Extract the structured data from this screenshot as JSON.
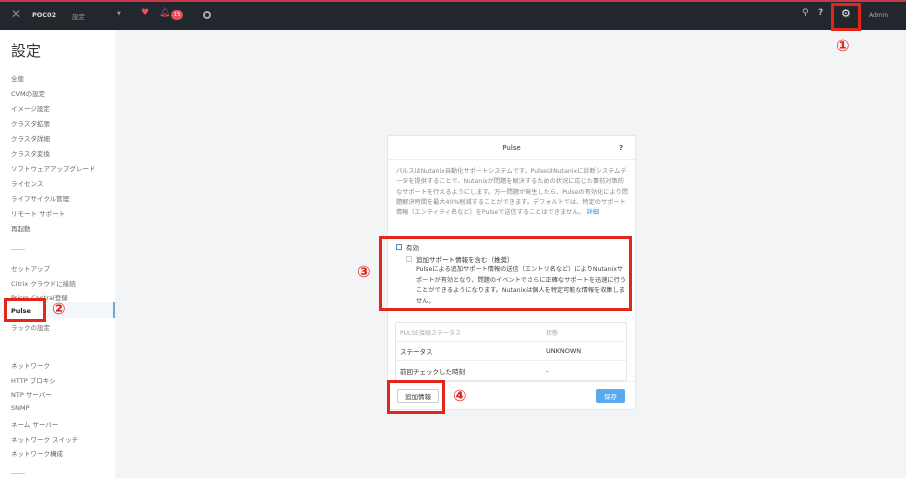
{
  "topbar": {
    "cluster": "POC02",
    "menu": "設定",
    "alert_count": "15",
    "user": "Admin"
  },
  "sidebar": {
    "title": "設定",
    "group1": [
      "全般",
      "CVMの設定",
      "イメージ設定",
      "クラスタ拡張",
      "クラスタ詳細",
      "クラスタ変換",
      "ソフトウェアアップグレード",
      "ライセンス",
      "ライフサイクル管理",
      "リモート サポート",
      "再起動"
    ],
    "group2": [
      "セットアップ",
      "Citrix クラウドに接続",
      "Prism Central登録",
      "Pulse",
      "ラックの設定"
    ],
    "group3": [
      "ネットワーク",
      "HTTP プロキシ",
      "NTP サーバー",
      "SNMP",
      "ネーム サーバー",
      "ネットワーク スイッチ",
      "ネットワーク構成"
    ]
  },
  "dialog": {
    "title": "Pulse",
    "help": "?",
    "description": "パルスはNutanix自動化サポートシステムです。PulseはNutanixに診断システムデータを提供することで、Nutanixが問題を解決するための状況に応じた事前対策的なサポートを行えるようにします。万一問題が発生したら、Pulseの有効化により問題解決時間を最大40%削減することができます。デフォルトでは、特定のサポート情報（エンティティ名など）をPulseで送信することはできません。",
    "details_link": "詳細",
    "enable_label": "有効",
    "include_label": "追加サポート情報を含む（推奨）",
    "include_desc": "Pulseによる追加サポート情報の送信（エントリ名など）によりNutanixサポートが有効となり、問題のイベントでさらに正確なサポートを迅速に行うことができるようになります。Nutanixは個人を特定可能な情報を収集しません。",
    "table": {
      "headers": [
        "PULSE接続ステータス",
        "状態"
      ],
      "rows": [
        [
          "ステータス",
          "UNKNOWN"
        ],
        [
          "前回チェックした時刻",
          "-"
        ]
      ]
    },
    "more_info": "追加情報",
    "save": "保存"
  },
  "annotations": [
    "①",
    "②",
    "③",
    "④"
  ]
}
